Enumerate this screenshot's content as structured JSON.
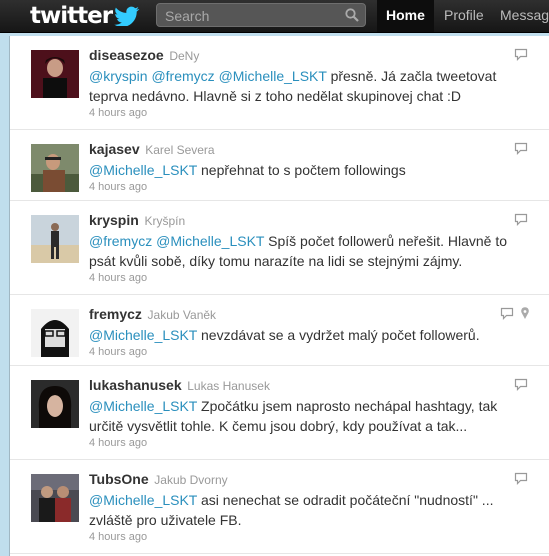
{
  "topbar": {
    "logo_text": "twitter",
    "search_placeholder": "Search",
    "tabs": [
      {
        "label": "Home",
        "active": true
      },
      {
        "label": "Profile",
        "active": false
      },
      {
        "label": "Messages",
        "active": false
      }
    ]
  },
  "tweets": [
    {
      "screen_name": "diseasezoe",
      "full_name": "DeNy",
      "parts": [
        {
          "t": "@kryspin",
          "m": true
        },
        {
          "t": " ",
          "m": false
        },
        {
          "t": "@fremycz",
          "m": true
        },
        {
          "t": " ",
          "m": false
        },
        {
          "t": "@Michelle_LSKT",
          "m": true
        },
        {
          "t": " přesně. Já začla tweetovat teprva nedávno. Hlavně si z toho nedělat skupinovej chat :D",
          "m": false
        }
      ],
      "time": "4 hours ago"
    },
    {
      "screen_name": "kajasev",
      "full_name": "Karel Severa",
      "parts": [
        {
          "t": "@Michelle_LSKT",
          "m": true
        },
        {
          "t": " nepřehnat to s počtem followings",
          "m": false
        }
      ],
      "time": "4 hours ago"
    },
    {
      "screen_name": "kryspin",
      "full_name": "Kryšpín",
      "parts": [
        {
          "t": "@fremycz",
          "m": true
        },
        {
          "t": " ",
          "m": false
        },
        {
          "t": "@Michelle_LSKT",
          "m": true
        },
        {
          "t": " Spíš počet followerů neřešit. Hlavně to psát kvůli sobě, díky tomu narazíte na lidi se stejnými zájmy.",
          "m": false
        }
      ],
      "time": "4 hours ago"
    },
    {
      "screen_name": "fremycz",
      "full_name": "Jakub Vaněk",
      "parts": [
        {
          "t": "@Michelle_LSKT",
          "m": true
        },
        {
          "t": " nevzdávat se a vydržet malý počet followerů.",
          "m": false
        }
      ],
      "time": "4 hours ago"
    },
    {
      "screen_name": "lukashanusek",
      "full_name": "Lukas Hanusek",
      "parts": [
        {
          "t": "@Michelle_LSKT",
          "m": true
        },
        {
          "t": " Zpočátku jsem naprosto nechápal hashtagy, tak určitě vysvětlit tohle. K čemu jsou dobrý, kdy používat a tak...",
          "m": false
        }
      ],
      "time": "4 hours ago"
    },
    {
      "screen_name": "TubsOne",
      "full_name": "Jakub Dvorny",
      "parts": [
        {
          "t": "@Michelle_LSKT",
          "m": true
        },
        {
          "t": " asi nenechat se odradit počáteční \"nudností\" ... zvláště pro uživatele FB.",
          "m": false
        }
      ],
      "time": "4 hours ago"
    }
  ]
}
